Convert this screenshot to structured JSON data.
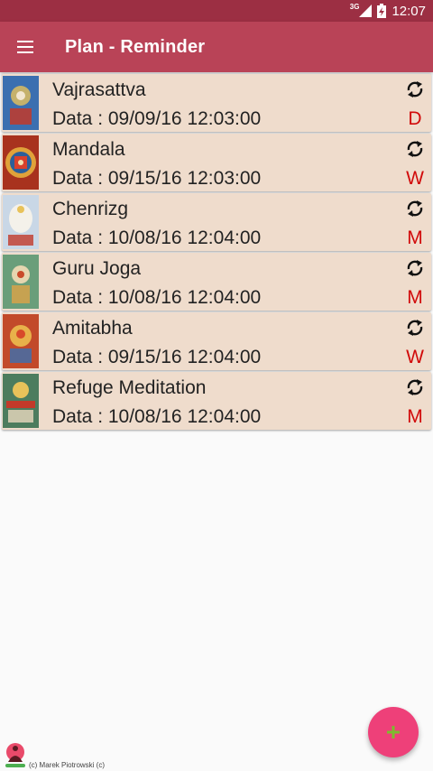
{
  "status_bar": {
    "time": "12:07",
    "network_label": "3G",
    "icons": [
      "signal-icon",
      "battery-icon"
    ]
  },
  "app_bar": {
    "title": "Plan - Reminder",
    "menu_icon": "hamburger-menu-icon"
  },
  "reminders": [
    {
      "name": "Vajrasattva",
      "date": "Data : 09/09/16 12:03:00",
      "frequency": "D",
      "thumb_color": "#3b6fb0"
    },
    {
      "name": "Mandala",
      "date": "Data : 09/15/16 12:03:00",
      "frequency": "W",
      "thumb_color": "#a8321e"
    },
    {
      "name": "Chenrizg",
      "date": "Data : 10/08/16 12:04:00",
      "frequency": "M",
      "thumb_color": "#c9d7e6"
    },
    {
      "name": "Guru Joga",
      "date": "Data : 10/08/16 12:04:00",
      "frequency": "M",
      "thumb_color": "#6a9e7a"
    },
    {
      "name": "Amitabha",
      "date": "Data : 09/15/16 12:04:00",
      "frequency": "W",
      "thumb_color": "#c24a2a"
    },
    {
      "name": "Refuge Meditation",
      "date": "Data : 10/08/16 12:04:00",
      "frequency": "M",
      "thumb_color": "#4c7c5e"
    }
  ],
  "fab": {
    "icon": "add-icon",
    "color": "#ee4079",
    "plus_color": "#7dbb2e"
  },
  "footer": {
    "copyright": "(c) Marek Piotrowski (c)"
  },
  "colors": {
    "status_bar": "#9c2f43",
    "app_bar": "#b94357",
    "card": "#efdccc",
    "frequency_text": "#d10a0a"
  }
}
